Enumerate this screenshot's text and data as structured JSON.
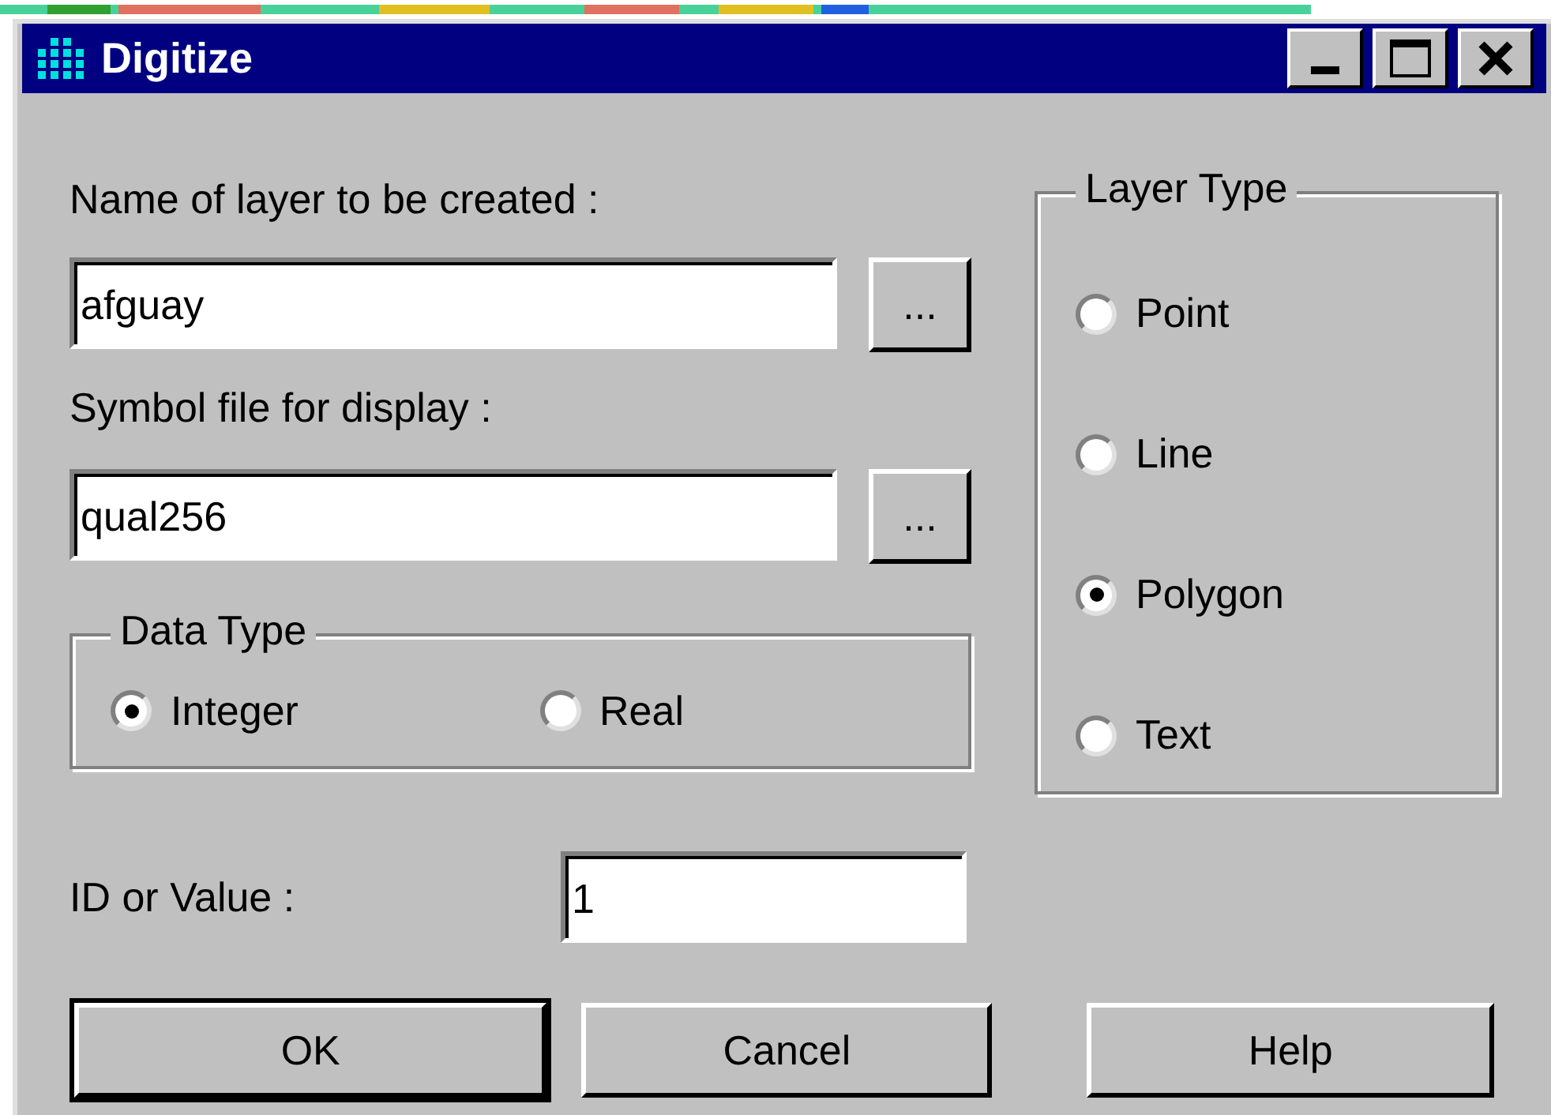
{
  "window": {
    "title": "Digitize"
  },
  "layer_name": {
    "label": "Name of layer to be created :",
    "value": "afguay",
    "browse": "..."
  },
  "symbol_file": {
    "label": "Symbol file for display :",
    "value": "qual256",
    "browse": "..."
  },
  "data_type": {
    "title": "Data Type",
    "options": [
      {
        "label": "Integer",
        "selected": true
      },
      {
        "label": "Real",
        "selected": false
      }
    ]
  },
  "layer_type": {
    "title": "Layer Type",
    "options": [
      {
        "label": "Point",
        "selected": false
      },
      {
        "label": "Line",
        "selected": false
      },
      {
        "label": "Polygon",
        "selected": true
      },
      {
        "label": "Text",
        "selected": false
      }
    ]
  },
  "id_value": {
    "label": "ID or Value :",
    "value": "1"
  },
  "buttons": [
    {
      "label": "OK",
      "default": true
    },
    {
      "label": "Cancel",
      "default": false
    },
    {
      "label": "Help",
      "default": false
    }
  ]
}
